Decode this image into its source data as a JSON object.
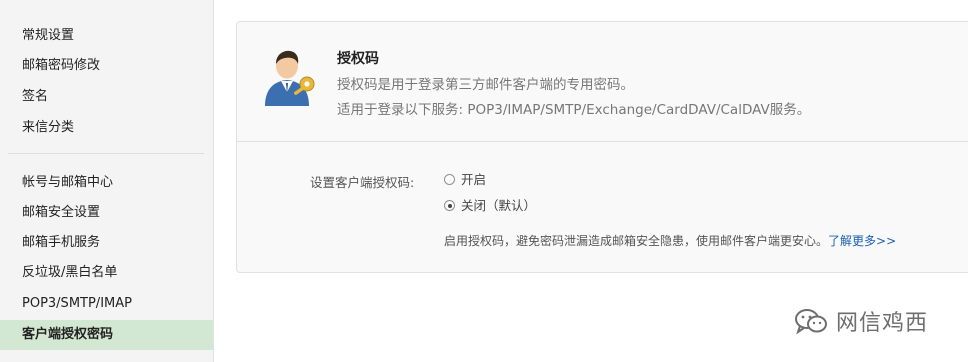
{
  "sidebar": {
    "items": [
      {
        "label": "常规设置"
      },
      {
        "label": "邮箱密码修改"
      },
      {
        "label": "签名"
      },
      {
        "label": "来信分类"
      },
      {
        "label": "帐号与邮箱中心"
      },
      {
        "label": "邮箱安全设置"
      },
      {
        "label": "邮箱手机服务"
      },
      {
        "label": "反垃圾/黑白名单"
      },
      {
        "label": "POP3/SMTP/IMAP"
      },
      {
        "label": "客户端授权密码"
      }
    ],
    "active_item": "客户端授权密码"
  },
  "auth": {
    "title": "授权码",
    "desc1": "授权码是用于登录第三方邮件客户端的专用密码。",
    "desc2": "适用于登录以下服务: POP3/IMAP/SMTP/Exchange/CardDAV/CalDAV服务。"
  },
  "setting": {
    "label": "设置客户端授权码:",
    "options": [
      {
        "label": "开启",
        "checked": false
      },
      {
        "label": "关闭（默认）",
        "checked": true
      }
    ],
    "hint": "启用授权码，避免密码泄漏造成邮箱安全隐患，使用邮件客户端更安心。",
    "link": "了解更多>>"
  },
  "watermark": {
    "text": "网信鸡西"
  },
  "colors": {
    "active_bg": "#d3e8d2",
    "link": "#1a5fb4",
    "panel_bg": "#f9f9f9"
  }
}
